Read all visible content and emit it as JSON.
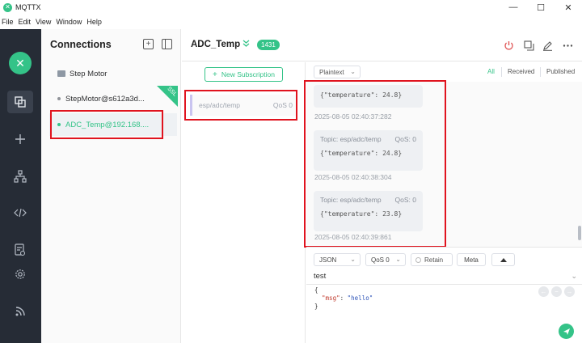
{
  "window": {
    "title": "MQTTX",
    "minimize": "—",
    "maximize": "☐",
    "close": "✕"
  },
  "menu": [
    "File",
    "Edit",
    "View",
    "Window",
    "Help"
  ],
  "connections": {
    "title": "Connections",
    "items": [
      {
        "label": "Step Motor",
        "type": "folder"
      },
      {
        "label": "StepMotor@s612a3d...",
        "status": "offline",
        "dot_color": "#909399"
      },
      {
        "label": "ADC_Temp@192.168....",
        "status": "online",
        "dot_color": "#34c388",
        "selected": true,
        "ssl": "SSL"
      }
    ]
  },
  "topbar": {
    "title": "ADC_Temp",
    "count": "1431"
  },
  "subscriptions": {
    "new_label": "New Subscription",
    "items": [
      {
        "topic": "esp/adc/temp",
        "qos": "QoS 0"
      }
    ]
  },
  "messages": {
    "format": "Plaintext",
    "filters": [
      "All",
      "Received",
      "Published"
    ],
    "list": [
      {
        "topic": "",
        "qos": "",
        "payload": "{\"temperature\": 24.8}",
        "time": "2025-08-05 02:40:37:282"
      },
      {
        "topic": "Topic: esp/adc/temp",
        "qos": "QoS: 0",
        "payload": "{\"temperature\": 24.8}",
        "time": "2025-08-05 02:40:38:304"
      },
      {
        "topic": "Topic: esp/adc/temp",
        "qos": "QoS: 0",
        "payload": "{\"temperature\": 23.8}",
        "time": "2025-08-05 02:40:39:861"
      }
    ]
  },
  "publish": {
    "payload_type": "JSON",
    "qos": "QoS 0",
    "retain": "Retain",
    "meta": "Meta",
    "topic": "test",
    "code_open": "{",
    "code_key": "\"msg\"",
    "code_colon": ": ",
    "code_value": "\"hello\"",
    "code_close": "}"
  },
  "colors": {
    "accent": "#34c388",
    "sidebar": "#262c36",
    "highlight": "#e0131e"
  }
}
